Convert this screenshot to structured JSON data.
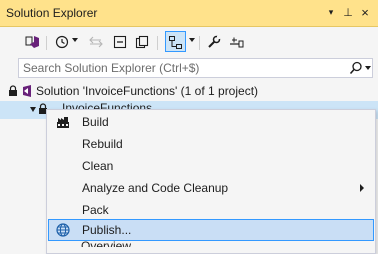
{
  "window": {
    "title": "Solution Explorer",
    "dropdown_glyph": "▾",
    "pin_glyph": "⊥",
    "close_glyph": "×"
  },
  "toolbar": {
    "icons": [
      "switch-views-icon",
      "history-icon",
      "back-icon",
      "collapse-all-icon",
      "show-all-files-icon",
      "sync-active-document-icon",
      "properties-icon",
      "preview-selected-items-icon"
    ]
  },
  "search": {
    "placeholder": "Search Solution Explorer (Ctrl+$)",
    "icon": "search-icon"
  },
  "tree": {
    "solution_label": "Solution 'InvoiceFunctions' (1 of 1 project)",
    "project_label": "InvoiceFunctions"
  },
  "context_menu": {
    "items": [
      {
        "label": "Build",
        "icon": "build-icon"
      },
      {
        "label": "Rebuild"
      },
      {
        "label": "Clean"
      },
      {
        "label": "Analyze and Code Cleanup",
        "submenu": true
      },
      {
        "label": "Pack"
      },
      {
        "label": "Publish...",
        "icon": "publish-globe-icon",
        "highlighted": true
      },
      {
        "label": "Overview"
      }
    ]
  },
  "colors": {
    "title_bar": "#ffe28b",
    "selection": "#cce4f7",
    "accent": "#3399ff",
    "background": "#f5f5f5"
  }
}
